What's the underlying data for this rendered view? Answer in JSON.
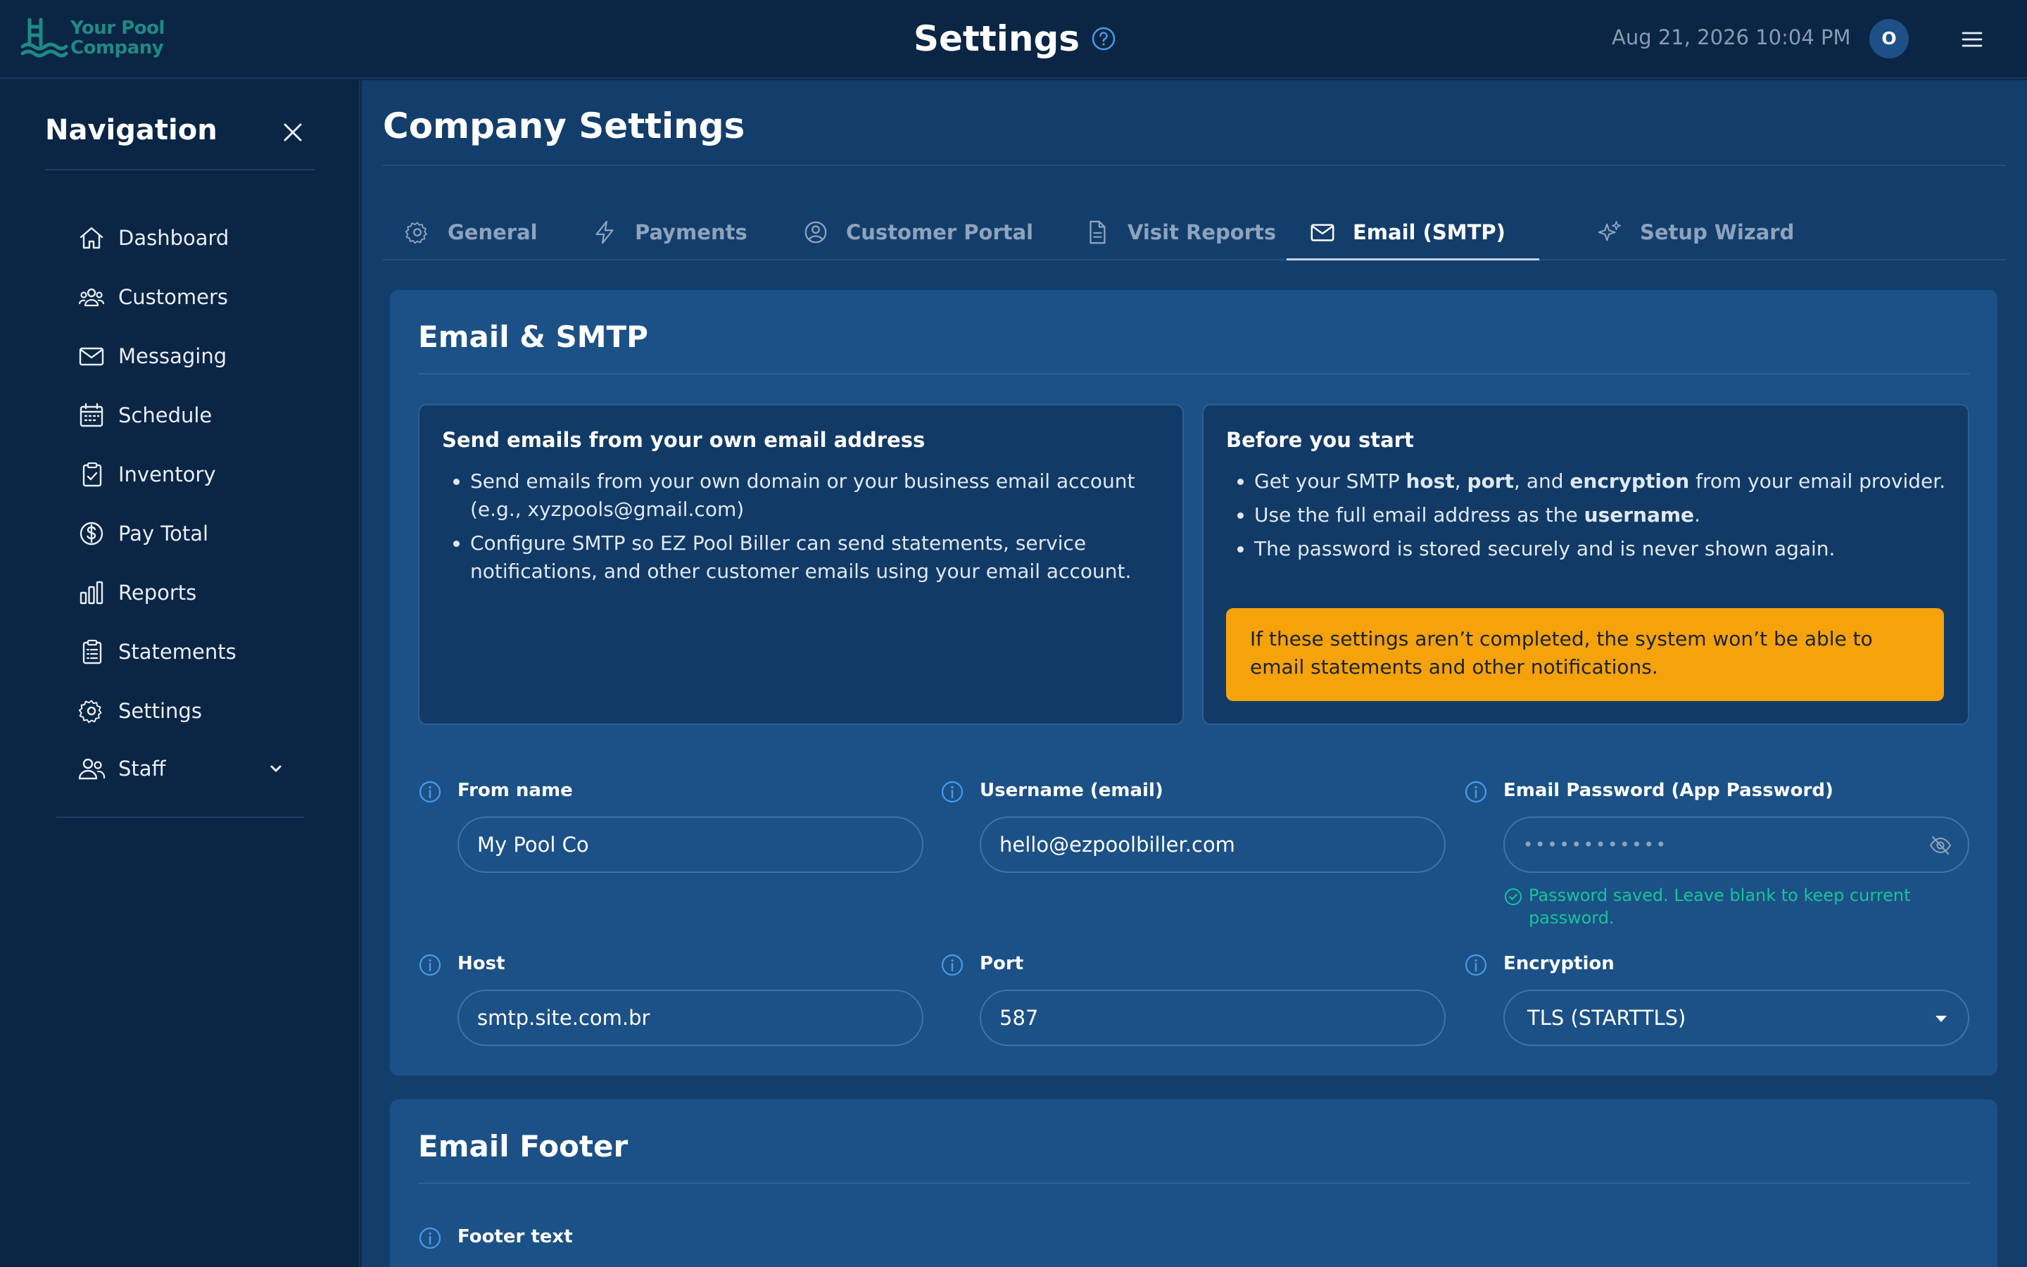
{
  "header": {
    "logo_text": "Your Pool Company",
    "title": "Settings",
    "datetime": "Aug 21, 2026 10:04 PM",
    "avatar_initial": "O"
  },
  "sidebar": {
    "title": "Navigation",
    "items": [
      {
        "label": "Dashboard",
        "icon": "home-icon"
      },
      {
        "label": "Customers",
        "icon": "users-icon"
      },
      {
        "label": "Messaging",
        "icon": "mail-icon"
      },
      {
        "label": "Schedule",
        "icon": "calendar-icon"
      },
      {
        "label": "Inventory",
        "icon": "clipboard-check-icon"
      },
      {
        "label": "Pay Total",
        "icon": "dollar-circle-icon"
      },
      {
        "label": "Reports",
        "icon": "bar-chart-icon"
      },
      {
        "label": "Statements",
        "icon": "clipboard-list-icon"
      },
      {
        "label": "Settings",
        "icon": "gear-icon"
      },
      {
        "label": "Staff",
        "icon": "staff-icon"
      }
    ]
  },
  "page": {
    "title": "Company Settings",
    "tabs": [
      {
        "label": "General",
        "icon": "gear-icon",
        "active": false
      },
      {
        "label": "Payments",
        "icon": "bolt-icon",
        "active": false
      },
      {
        "label": "Customer Portal",
        "icon": "user-circle-icon",
        "active": false
      },
      {
        "label": "Visit Reports",
        "icon": "document-icon",
        "active": false
      },
      {
        "label": "Email (SMTP)",
        "icon": "mail-icon",
        "active": true
      },
      {
        "label": "Setup Wizard",
        "icon": "sparkles-icon",
        "active": false
      }
    ]
  },
  "smtp_card": {
    "title": "Email & SMTP",
    "left_box": {
      "title": "Send emails from your own email address",
      "bullets": [
        "Send emails from your own domain or your business email account (e.g., xyzpools@gmail.com)",
        "Configure SMTP so EZ Pool Biller can send statements, service notifications, and other customer emails using your email account."
      ]
    },
    "right_box": {
      "title": "Before you start",
      "bullet1": {
        "a": "Get your SMTP ",
        "b": "host",
        "c": ", ",
        "d": "port",
        "e": ", and ",
        "f": "encryption",
        "g": " from your email provider."
      },
      "bullet2": {
        "a": "Use the full email address as the ",
        "b": "username",
        "c": "."
      },
      "bullet3": "The password is stored securely and is never shown again.",
      "warning": "If these settings aren’t completed, the system won’t be able to email statements and other notifications."
    },
    "fields": {
      "from_name": {
        "label": "From name",
        "value": "My Pool Co"
      },
      "username": {
        "label": "Username (email)",
        "value": "hello@ezpoolbiller.com"
      },
      "password": {
        "label": "Email Password (App Password)",
        "value": "••••••••••••",
        "note": "Password saved. Leave blank to keep current password."
      },
      "host": {
        "label": "Host",
        "value": "smtp.site.com.br"
      },
      "port": {
        "label": "Port",
        "value": "587"
      },
      "encryption": {
        "label": "Encryption",
        "value": "TLS (STARTTLS)"
      }
    }
  },
  "footer_card": {
    "title": "Email Footer",
    "footer_text_label": "Footer text"
  },
  "colors": {
    "background": "#0b2848",
    "card": "#1b5186",
    "warning": "#f5a20b",
    "success": "#19c49a",
    "accent": "#4a9ae8"
  }
}
